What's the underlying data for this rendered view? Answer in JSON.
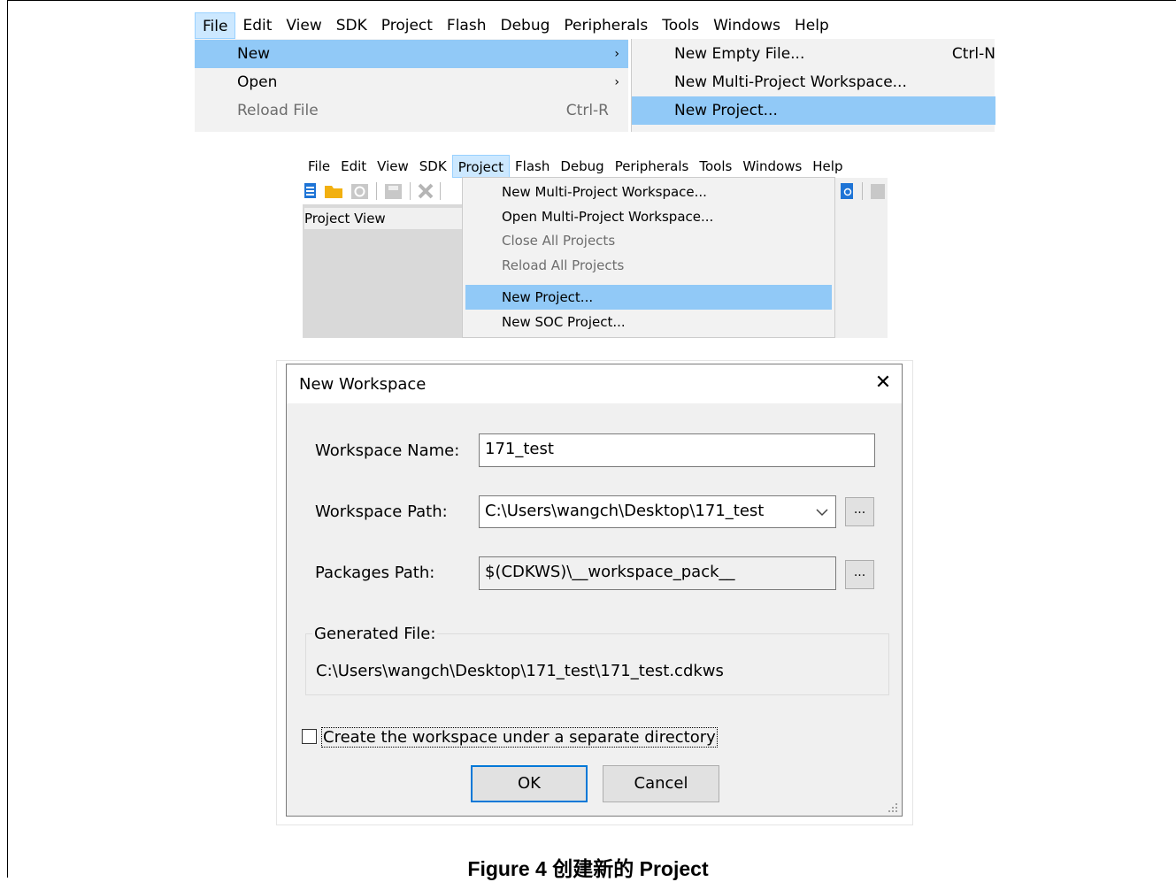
{
  "menubar_full": {
    "items": [
      "File",
      "Edit",
      "View",
      "SDK",
      "Project",
      "Flash",
      "Debug",
      "Peripherals",
      "Tools",
      "Windows",
      "Help"
    ],
    "selected": "File"
  },
  "file_menu": {
    "items": [
      {
        "label": "New",
        "shortcut": "",
        "arrow": "›",
        "highlighted": true,
        "disabled": false
      },
      {
        "label": "Open",
        "shortcut": "",
        "arrow": "›",
        "highlighted": false,
        "disabled": false
      },
      {
        "label": "Reload File",
        "shortcut": "Ctrl-R",
        "arrow": "",
        "highlighted": false,
        "disabled": true
      }
    ]
  },
  "new_submenu": {
    "items": [
      {
        "label": "New Empty File...",
        "shortcut": "Ctrl-N",
        "highlighted": false
      },
      {
        "label": "New Multi-Project Workspace...",
        "shortcut": "",
        "highlighted": false
      },
      {
        "label": "New Project...",
        "shortcut": "",
        "highlighted": true
      }
    ]
  },
  "menubar_small": {
    "items": [
      "File",
      "Edit",
      "View",
      "SDK",
      "Project",
      "Flash",
      "Debug",
      "Peripherals",
      "Tools",
      "Windows",
      "Help"
    ],
    "selected": "Project"
  },
  "project_view": {
    "title": "Project View"
  },
  "project_menu": {
    "items": [
      {
        "label": "New Multi-Project Workspace...",
        "disabled": false,
        "highlighted": false
      },
      {
        "label": "Open Multi-Project Workspace...",
        "disabled": false,
        "highlighted": false
      },
      {
        "label": "Close All Projects",
        "disabled": true,
        "highlighted": false
      },
      {
        "label": "Reload All Projects",
        "disabled": true,
        "highlighted": false
      },
      {
        "label": "New Project...",
        "disabled": false,
        "highlighted": true
      },
      {
        "label": "New SOC Project...",
        "disabled": false,
        "highlighted": false
      }
    ]
  },
  "dialog": {
    "title": "New Workspace",
    "close_glyph": "✕",
    "workspace_name_label": "Workspace Name:",
    "workspace_name_value": "171_test",
    "workspace_path_label": "Workspace Path:",
    "workspace_path_value": "C:\\Users\\wangch\\Desktop\\171_test",
    "packages_path_label": "Packages Path:",
    "packages_path_value": "$(CDKWS)\\__workspace_pack__",
    "browse_label": "...",
    "generated_file_label": "Generated File:",
    "generated_file_value": "C:\\Users\\wangch\\Desktop\\171_test\\171_test.cdkws",
    "separate_dir_label": "Create the workspace under a separate directory",
    "separate_dir_checked": false,
    "ok_label": "OK",
    "cancel_label": "Cancel"
  },
  "caption": "Figure 4  创建新的 Project",
  "colors": {
    "highlight": "#91c9f7",
    "menu_bg": "#f2f2f2",
    "accent": "#0078d7"
  }
}
